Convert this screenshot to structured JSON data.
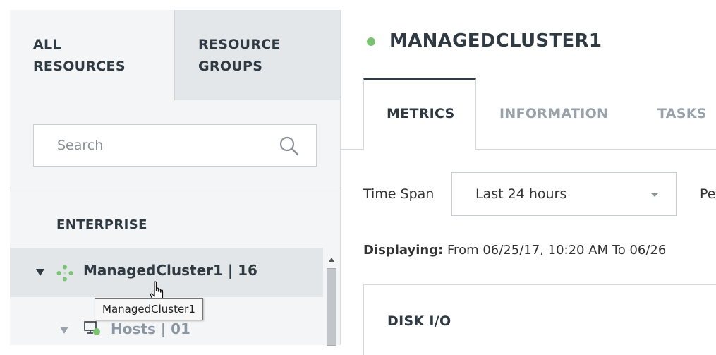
{
  "left_panel": {
    "tabs": [
      {
        "label": "ALL RESOURCES",
        "active": true
      },
      {
        "label": "RESOURCE GROUPS",
        "active": false
      }
    ],
    "search": {
      "placeholder": "Search",
      "value": ""
    },
    "section_title": "ENTERPRISE",
    "tree": [
      {
        "label": "ManagedCluster1 | 16",
        "expanded": true,
        "selected": true,
        "icon": "cluster-icon"
      },
      {
        "label": "Hosts | 01",
        "expanded": true,
        "selected": false,
        "icon": "host-icon"
      }
    ],
    "tooltip": "ManagedCluster1"
  },
  "right_panel": {
    "title": "MANAGEDCLUSTER1",
    "status_color": "#79c471",
    "tabs": [
      {
        "label": "METRICS",
        "active": true
      },
      {
        "label": "INFORMATION",
        "active": false
      },
      {
        "label": "TASKS",
        "active": false
      }
    ],
    "time_span": {
      "label": "Time Span",
      "selected": "Last 24 hours"
    },
    "next_label_partial": "Pe",
    "displaying": {
      "label": "Displaying:",
      "text": "From 06/25/17, 10:20 AM To 06/26"
    },
    "card_title": "DISK I/O"
  },
  "colors": {
    "accent_dark": "#2f3a43",
    "status_green": "#79c471",
    "panel_bg": "#f4f5f6",
    "inactive_tab_bg": "#e4e7ea"
  }
}
